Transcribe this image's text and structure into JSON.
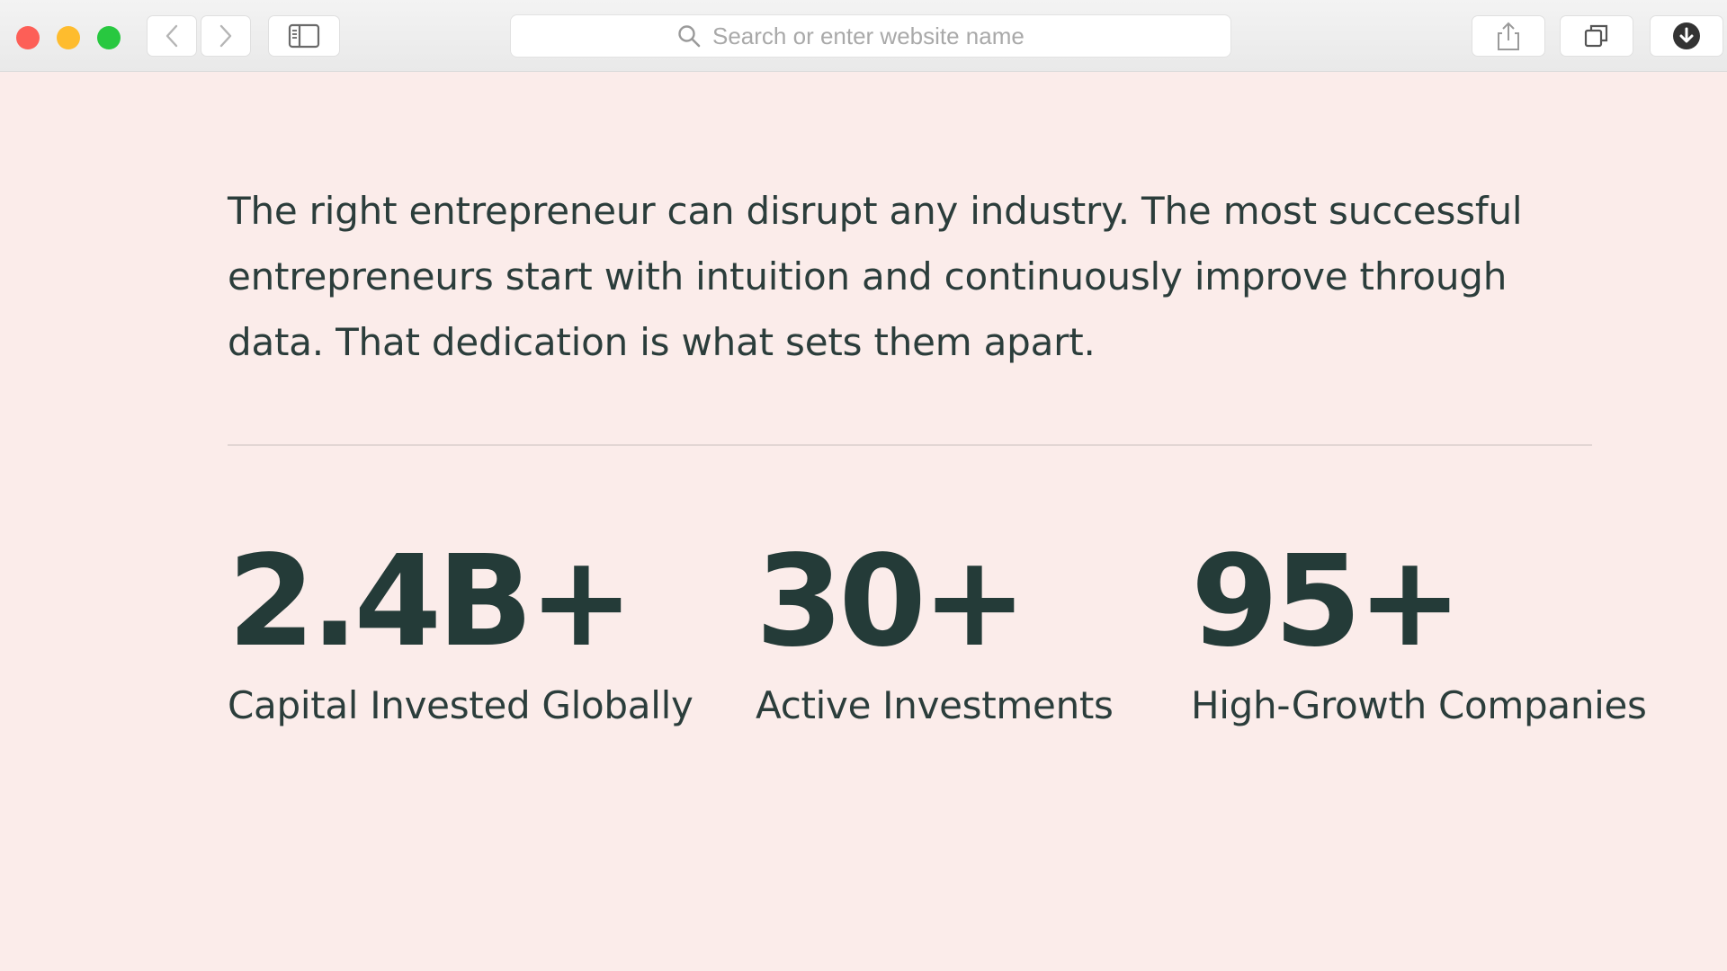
{
  "browser": {
    "address_placeholder": "Search or enter website name",
    "colors": {
      "close": "#fd5f57",
      "minimize": "#febc2e",
      "zoom": "#28c840"
    },
    "icons": [
      "back-chevron-icon",
      "forward-chevron-icon",
      "sidebar-icon",
      "search-icon",
      "share-icon",
      "tabs-icon",
      "download-icon"
    ]
  },
  "page": {
    "background": "#fbecea",
    "text_color": "#2b3d3b",
    "intro": "The right entrepreneur can disrupt any industry. The most successful entrepreneurs start with intuition and continuously improve through data. That dedication is what sets them apart.",
    "stats": [
      {
        "value": "2.4B+",
        "label": "Capital Invested Globally"
      },
      {
        "value": "30+",
        "label": "Active Investments"
      },
      {
        "value": "95+",
        "label": "High-Growth Companies"
      }
    ]
  }
}
